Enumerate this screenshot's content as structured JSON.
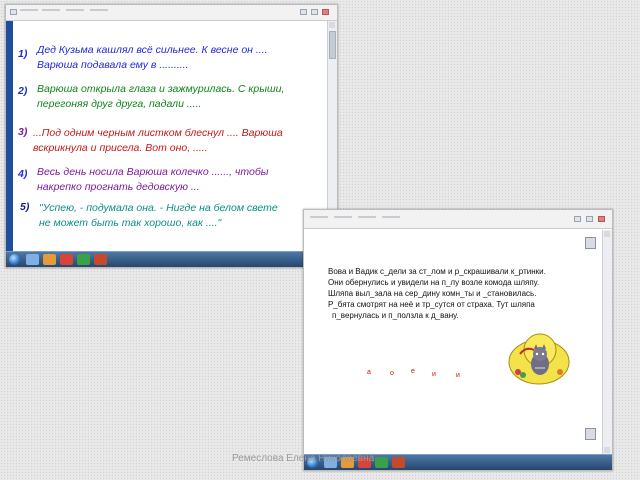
{
  "slide1": {
    "items": [
      {
        "num": "1)",
        "lines": [
          "Дед Кузьма кашлял всё сильнее. К весне он ....",
          "Варюша подавала ему в .........."
        ]
      },
      {
        "num": "2)",
        "lines": [
          "Варюша открыла глаза и зажмурилась. С крыши,",
          "перегоняя друг друга, падали ....."
        ]
      },
      {
        "num": "3)",
        "lines": [
          "...Под одним черным листком блеснул .... Варюша",
          "вскрикнула и присела. Вот оно, ....."
        ]
      },
      {
        "num": "4)",
        "lines": [
          "Весь день носила Варюша колечко ......, чтобы",
          "накрепко прогнать дедовскую ..."
        ]
      },
      {
        "num": "5)",
        "lines": [
          "\"Успею, - подумала она. - Нигде на белом свете",
          "не может быть так хорошо, как ....\""
        ]
      }
    ]
  },
  "slide2": {
    "text_lines": [
      "Вова и Вадик с_дели за ст_лом и р_скрашивали к_ртинки.",
      "Они обернулись и увидели на п_лу возле комода шляпу.",
      "Шляпа выл_зала на сер_дину комн_ты и _становилась.",
      "Р_бята смотрят на неё и тр_сутся от страха. Тут шляпа",
      "п_вернулась и п_ползла к д_вану."
    ],
    "letters": [
      "а",
      "о",
      "е",
      "и",
      "и"
    ]
  },
  "watermark": "Ремеслова Елена Николаевна",
  "colors": {
    "item_numbers": [
      "#1f2ad8",
      "#1f2ad8",
      "#7a1a9c",
      "#1f2ad8",
      "#1a1a92"
    ],
    "item_text": [
      "#1f2ad8",
      "#10841a",
      "#c41616",
      "#7a1a9c",
      "#0a8f84"
    ],
    "letters": "#d01010"
  }
}
